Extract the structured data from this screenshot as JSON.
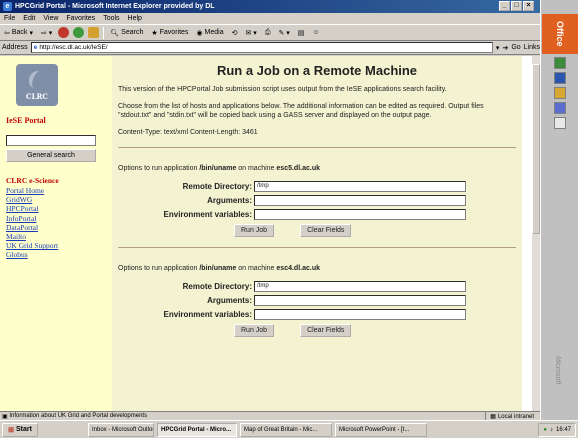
{
  "window": {
    "title": "HPCGrid Portal - Microsoft Internet Explorer provided by DL"
  },
  "menu": [
    "File",
    "Edit",
    "View",
    "Favorites",
    "Tools",
    "Help"
  ],
  "toolbar": {
    "back": "Back",
    "search": "Search",
    "favorites": "Favorites",
    "media": "Media"
  },
  "address": {
    "label": "Address",
    "url": "http://esc.dl.ac.uk/IeSE/",
    "go": "Go",
    "links": "Links"
  },
  "office": {
    "logo": "Office",
    "vendor": "Microsoft"
  },
  "sidebar": {
    "logo_text": "CLRC",
    "portal_title": "IeSE Portal",
    "search_value": "",
    "search_button": "General search",
    "section_title": "CLRC e-Science",
    "links": [
      "Portal Home",
      "GridWG",
      "HPCPortal",
      "InfoPortal",
      "DataPortal",
      "Mailto",
      "UK Grid Support",
      "Globus"
    ]
  },
  "main": {
    "heading": "Run a Job on a Remote Machine",
    "intro": "This version of the HPCPortal Job submission script uses output from the IeSE applications search facility.",
    "instructions": "Choose from the list of hosts and applications below. The additional information can be edited as required. Output files \"stdout.txt\" and \"stdin.txt\" will be copied back using a GASS server and displayed on the output page.",
    "content_type": "Content-Type: text/xml Content-Length: 3461",
    "options_prefix": "Options to run application",
    "on_machine": "on machine",
    "labels": {
      "remote_dir": "Remote Directory:",
      "arguments": "Arguments:",
      "env_vars": "Environment variables:"
    },
    "buttons": {
      "run": "Run Job",
      "clear": "Clear Fields"
    },
    "jobs": [
      {
        "application": "/bin/uname",
        "machine": "esc5.dl.ac.uk",
        "remote_dir": "/tmp",
        "arguments": "",
        "env_vars": ""
      },
      {
        "application": "/bin/uname",
        "machine": "esc4.dl.ac.uk",
        "remote_dir": "/tmp",
        "arguments": "",
        "env_vars": ""
      }
    ]
  },
  "status": {
    "text": "Information about UK Grid and Portal developments",
    "zone": "Local intranet"
  },
  "taskbar": {
    "start": "Start",
    "tasks": [
      "Inbox - Microsoft Outlook",
      "HPCGrid Portal - Micro...",
      "Map of Great Britain - Mic...",
      "Microsoft PowerPoint - [t..."
    ],
    "clock": "16:47"
  }
}
